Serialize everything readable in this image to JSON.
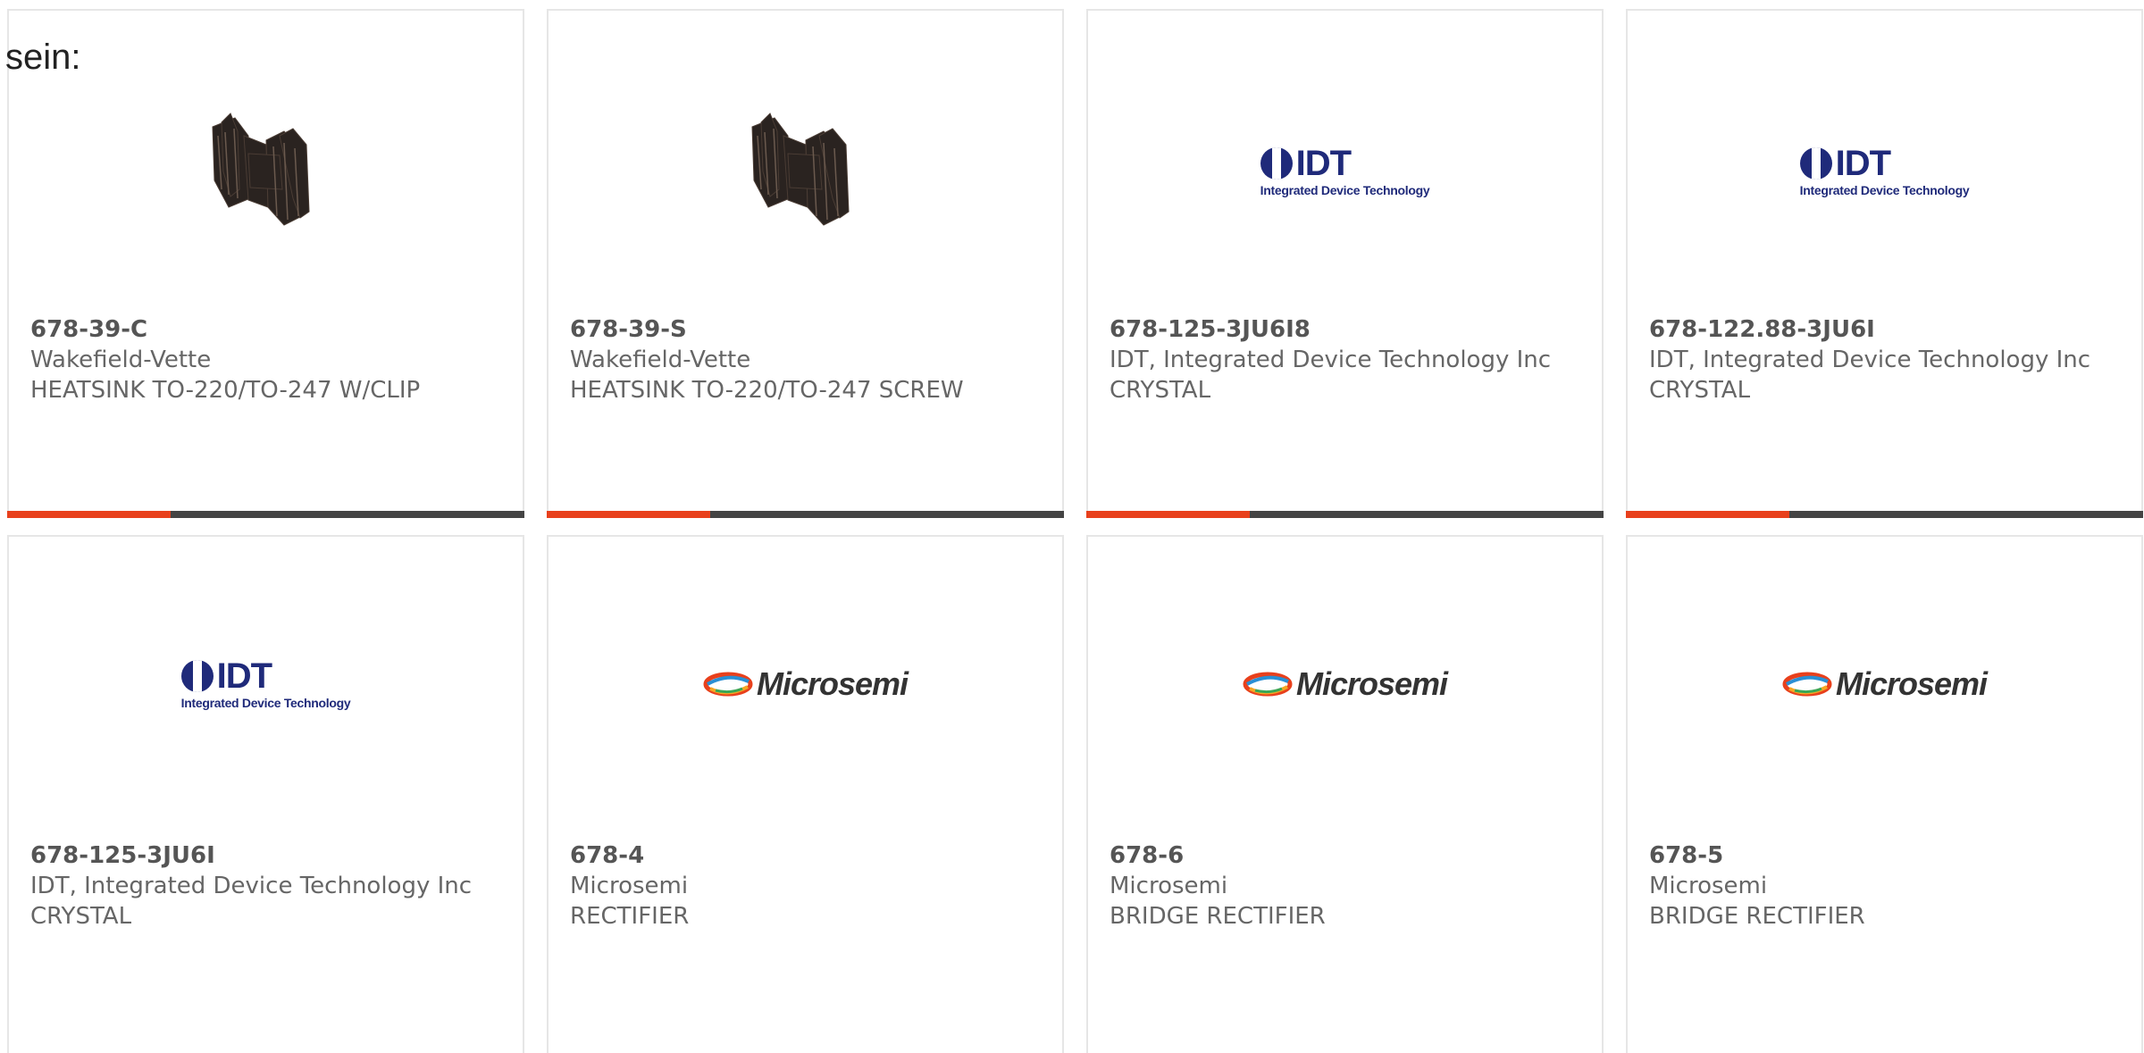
{
  "intro_text": "sein:",
  "products": [
    {
      "part_number": "678-39-C",
      "manufacturer": "Wakefield-Vette",
      "description": "HEATSINK TO-220/TO-247 W/CLIP",
      "image_icon": "heatsink-image"
    },
    {
      "part_number": "678-39-S",
      "manufacturer": "Wakefield-Vette",
      "description": "HEATSINK TO-220/TO-247 SCREW",
      "image_icon": "heatsink-image"
    },
    {
      "part_number": "678-125-3JU6I8",
      "manufacturer": "IDT, Integrated Device Technology Inc",
      "description": "CRYSTAL",
      "image_icon": "idt-logo"
    },
    {
      "part_number": "678-122.88-3JU6I",
      "manufacturer": "IDT, Integrated Device Technology Inc",
      "description": "CRYSTAL",
      "image_icon": "idt-logo"
    },
    {
      "part_number": "678-125-3JU6I",
      "manufacturer": "IDT, Integrated Device Technology Inc",
      "description": "CRYSTAL",
      "image_icon": "idt-logo"
    },
    {
      "part_number": "678-4",
      "manufacturer": "Microsemi",
      "description": "RECTIFIER",
      "image_icon": "microsemi-logo"
    },
    {
      "part_number": "678-6",
      "manufacturer": "Microsemi",
      "description": "BRIDGE RECTIFIER",
      "image_icon": "microsemi-logo"
    },
    {
      "part_number": "678-5",
      "manufacturer": "Microsemi",
      "description": "BRIDGE RECTIFIER",
      "image_icon": "microsemi-logo"
    }
  ],
  "logos": {
    "idt_wordmark": "IDT",
    "idt_tagline": "Integrated Device Technology",
    "microsemi_wordmark": "Microsemi"
  },
  "colors": {
    "accent": "#e8401c",
    "bar": "#444444",
    "card_border": "#e6e6e6",
    "text": "#666666",
    "idt_blue": "#1f2a7a"
  }
}
